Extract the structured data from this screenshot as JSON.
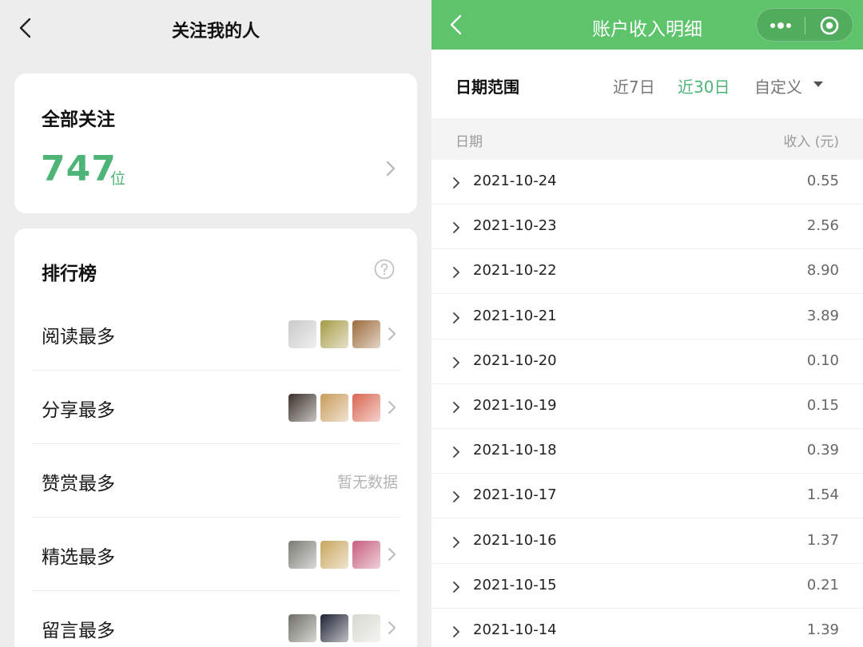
{
  "left": {
    "header": {
      "title": "关注我的人"
    },
    "total": {
      "title": "全部关注",
      "count": "747",
      "unit": "位"
    },
    "ranking": {
      "title": "排行榜",
      "rows": [
        {
          "label": "阅读最多",
          "avatars": [
            "#c9c9c9",
            "#a59b45",
            "#9c6a3a"
          ],
          "no_data": ""
        },
        {
          "label": "分享最多",
          "avatars": [
            "#3b3028",
            "#c99b5a",
            "#d9654f"
          ],
          "no_data": ""
        },
        {
          "label": "赞赏最多",
          "avatars": [],
          "no_data": "暂无数据"
        },
        {
          "label": "精选最多",
          "avatars": [
            "#7b7b74",
            "#c8a55d",
            "#c75d7e"
          ],
          "no_data": ""
        },
        {
          "label": "留言最多",
          "avatars": [
            "#6f6f66",
            "#1d2233",
            "#d8d8d0"
          ],
          "no_data": ""
        }
      ]
    }
  },
  "right": {
    "header": {
      "title": "账户收入明细"
    },
    "filter": {
      "label": "日期范围",
      "options": [
        "近7日",
        "近30日",
        "自定义"
      ],
      "active": "近30日"
    },
    "table": {
      "col_date": "日期",
      "col_income": "收入 (元)",
      "rows": [
        {
          "date": "2021-10-24",
          "income": "0.55"
        },
        {
          "date": "2021-10-23",
          "income": "2.56"
        },
        {
          "date": "2021-10-22",
          "income": "8.90"
        },
        {
          "date": "2021-10-21",
          "income": "3.89"
        },
        {
          "date": "2021-10-20",
          "income": "0.10"
        },
        {
          "date": "2021-10-19",
          "income": "0.15"
        },
        {
          "date": "2021-10-18",
          "income": "0.39"
        },
        {
          "date": "2021-10-17",
          "income": "1.54"
        },
        {
          "date": "2021-10-16",
          "income": "1.37"
        },
        {
          "date": "2021-10-15",
          "income": "0.21"
        },
        {
          "date": "2021-10-14",
          "income": "1.39"
        }
      ]
    }
  },
  "colors": {
    "accent_green": "#4fb477",
    "nav_green": "#5ec46c"
  }
}
